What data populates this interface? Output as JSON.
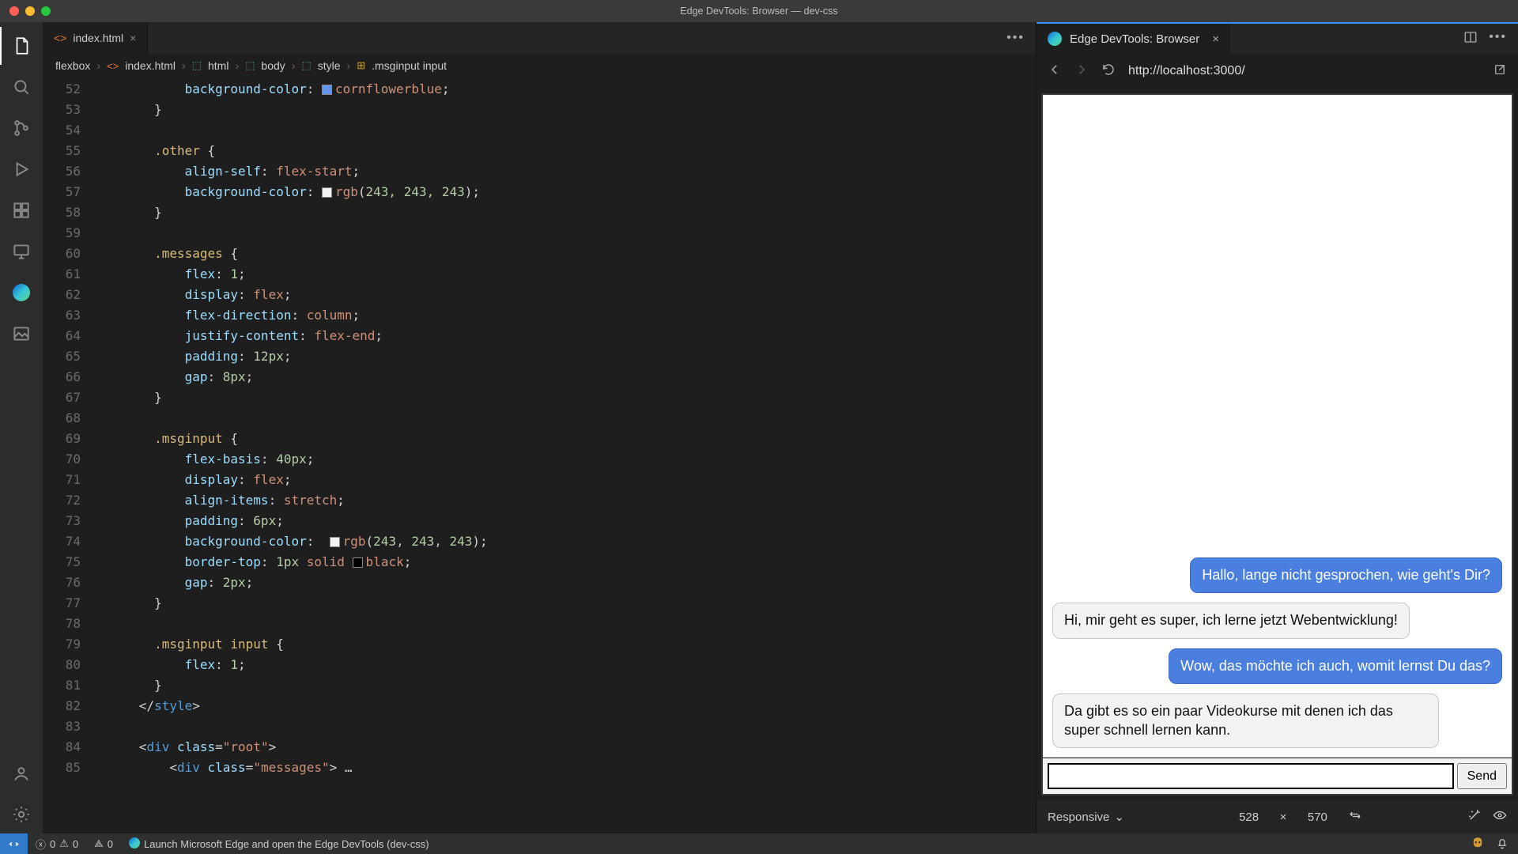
{
  "window": {
    "title": "Edge DevTools: Browser — dev-css"
  },
  "editor_tab": {
    "filename": "index.html",
    "close_glyph": "×"
  },
  "breadcrumb": {
    "project": "flexbox",
    "file": "index.html",
    "el_html": "html",
    "el_body": "body",
    "el_style": "style",
    "selector": ".msginput input"
  },
  "code_lines": [
    {
      "n": 52,
      "indent": 12,
      "t": "prop",
      "prop": "background-color",
      "swatch": "#6495ed",
      "val": "cornflowerblue"
    },
    {
      "n": 53,
      "indent": 8,
      "t": "close"
    },
    {
      "n": 54,
      "indent": 0,
      "t": "blank"
    },
    {
      "n": 55,
      "indent": 8,
      "t": "sel",
      "sel": ".other"
    },
    {
      "n": 56,
      "indent": 12,
      "t": "prop",
      "prop": "align-self",
      "val": "flex-start"
    },
    {
      "n": 57,
      "indent": 12,
      "t": "prop",
      "prop": "background-color",
      "swatch": "rgb(243,243,243)",
      "fn": "rgb",
      "args": "243, 243, 243"
    },
    {
      "n": 58,
      "indent": 8,
      "t": "close"
    },
    {
      "n": 59,
      "indent": 0,
      "t": "blank"
    },
    {
      "n": 60,
      "indent": 8,
      "t": "sel",
      "sel": ".messages"
    },
    {
      "n": 61,
      "indent": 12,
      "t": "prop",
      "prop": "flex",
      "num": "1"
    },
    {
      "n": 62,
      "indent": 12,
      "t": "prop",
      "prop": "display",
      "val": "flex"
    },
    {
      "n": 63,
      "indent": 12,
      "t": "prop",
      "prop": "flex-direction",
      "val": "column"
    },
    {
      "n": 64,
      "indent": 12,
      "t": "prop",
      "prop": "justify-content",
      "val": "flex-end"
    },
    {
      "n": 65,
      "indent": 12,
      "t": "prop",
      "prop": "padding",
      "num": "12px"
    },
    {
      "n": 66,
      "indent": 12,
      "t": "prop",
      "prop": "gap",
      "num": "8px"
    },
    {
      "n": 67,
      "indent": 8,
      "t": "close"
    },
    {
      "n": 68,
      "indent": 0,
      "t": "blank"
    },
    {
      "n": 69,
      "indent": 8,
      "t": "sel",
      "sel": ".msginput"
    },
    {
      "n": 70,
      "indent": 12,
      "t": "prop",
      "prop": "flex-basis",
      "num": "40px"
    },
    {
      "n": 71,
      "indent": 12,
      "t": "prop",
      "prop": "display",
      "val": "flex"
    },
    {
      "n": 72,
      "indent": 12,
      "t": "prop",
      "prop": "align-items",
      "val": "stretch"
    },
    {
      "n": 73,
      "indent": 12,
      "t": "prop",
      "prop": "padding",
      "num": "6px"
    },
    {
      "n": 74,
      "indent": 12,
      "t": "prop",
      "prop": "background-color",
      "swatch": "rgb(243,243,243)",
      "fn": "rgb",
      "args": "243, 243, 243",
      "trailspace": true
    },
    {
      "n": 75,
      "indent": 12,
      "t": "prop",
      "prop": "border-top",
      "num": "1px",
      "val": "solid",
      "swatch2": "#000",
      "val2": "black"
    },
    {
      "n": 76,
      "indent": 12,
      "t": "prop",
      "prop": "gap",
      "num": "2px"
    },
    {
      "n": 77,
      "indent": 8,
      "t": "close"
    },
    {
      "n": 78,
      "indent": 0,
      "t": "blank"
    },
    {
      "n": 79,
      "indent": 8,
      "t": "sel",
      "sel": ".msginput input"
    },
    {
      "n": 80,
      "indent": 12,
      "t": "prop",
      "prop": "flex",
      "num": "1"
    },
    {
      "n": 81,
      "indent": 8,
      "t": "close"
    },
    {
      "n": 82,
      "indent": 6,
      "t": "endstyle"
    },
    {
      "n": 83,
      "indent": 0,
      "t": "blank"
    },
    {
      "n": 84,
      "indent": 6,
      "t": "divopen",
      "cls": "root"
    },
    {
      "n": 85,
      "indent": 10,
      "t": "divopen",
      "cls": "messages",
      "fold": true
    }
  ],
  "dev": {
    "tab_title": "Edge DevTools: Browser",
    "close_glyph": "×",
    "url": "http://localhost:3000/",
    "messages": [
      {
        "who": "me",
        "text": "Hallo, lange nicht gesprochen, wie geht's Dir?"
      },
      {
        "who": "other",
        "text": "Hi, mir geht es super, ich lerne jetzt Webentwicklung!"
      },
      {
        "who": "me",
        "text": "Wow, das möchte ich auch, womit lernst Du das?"
      },
      {
        "who": "other",
        "text": "Da gibt es so ein paar Videokurse mit denen ich das super schnell lernen kann."
      }
    ],
    "send_label": "Send",
    "footer": {
      "mode": "Responsive",
      "w": "528",
      "h": "570"
    }
  },
  "status": {
    "errors": "0",
    "warnings": "0",
    "ports": "0",
    "launch_text": "Launch Microsoft Edge and open the Edge DevTools (dev-css)"
  }
}
